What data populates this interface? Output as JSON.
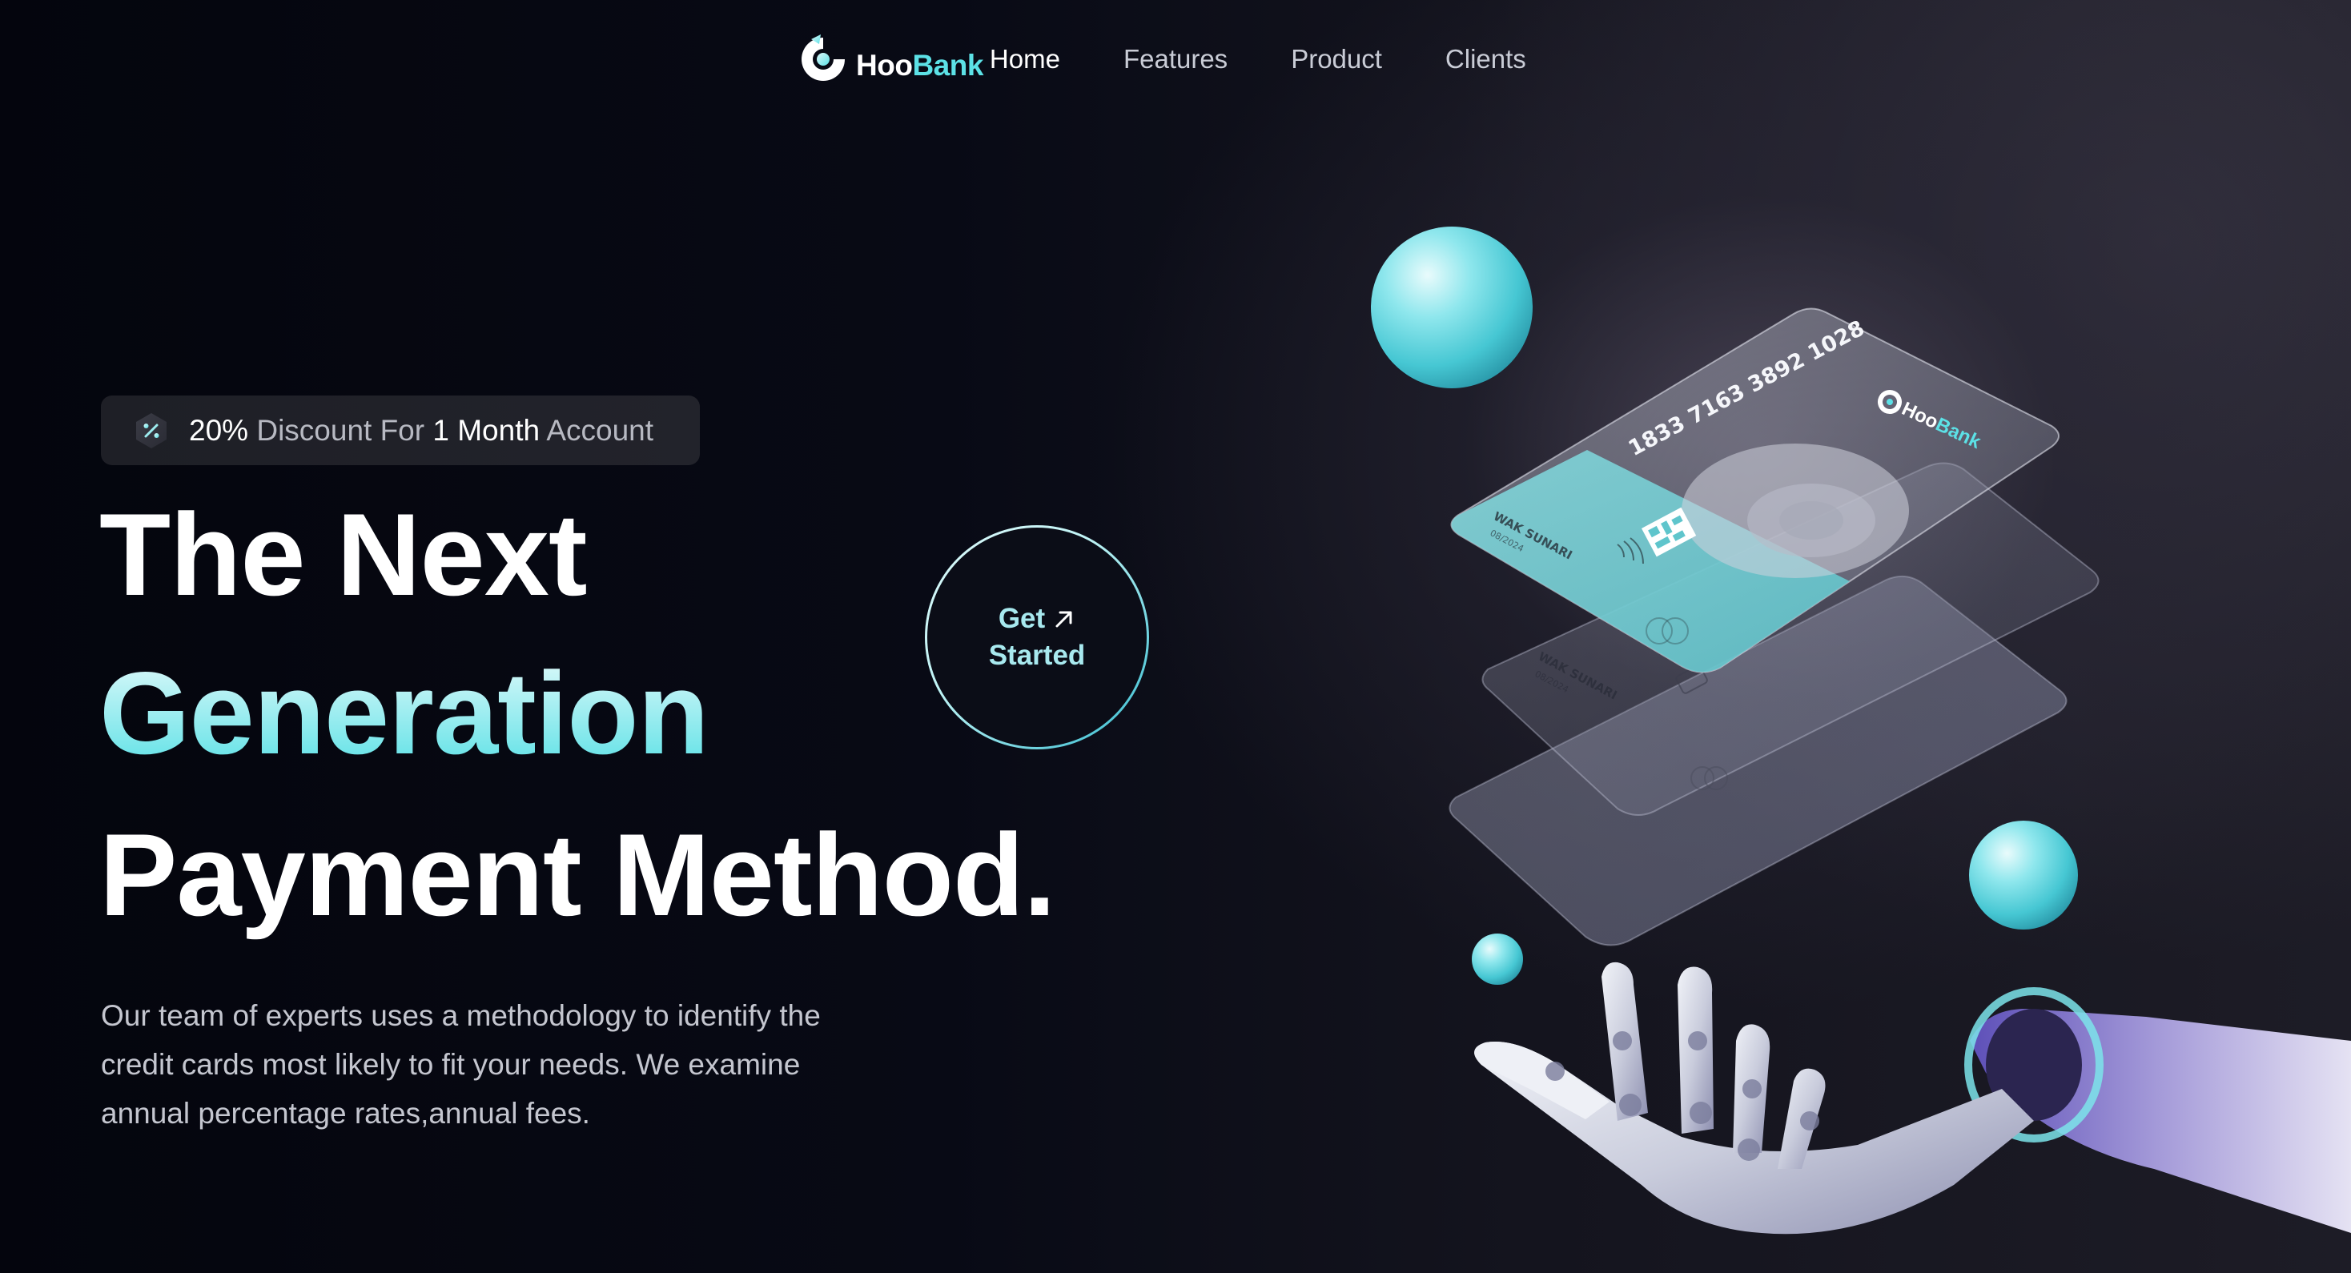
{
  "brand": {
    "name_part1": "Hoo",
    "name_part2": "Bank",
    "accent": "#5ce1e6"
  },
  "nav": {
    "links": [
      "Home",
      "Features",
      "Product",
      "Clients"
    ],
    "active": "Home"
  },
  "badge": {
    "icon": "discount-icon",
    "pct": "20%",
    "word1": "Discount",
    "word2": "For",
    "num": "1",
    "word3": "Month",
    "word4": "Account"
  },
  "hero": {
    "line1": "The Next",
    "line2": "Generation",
    "line3": "Payment Method.",
    "description": "Our team of experts uses a methodology to identify the credit cards most likely to fit your needs. We examine annual percentage rates,annual fees."
  },
  "cta": {
    "line1": "Get",
    "line2": "Started",
    "icon": "arrow-up-right-icon"
  },
  "cards": {
    "number": "1833 7163 3892 1028",
    "holder": "WAK SUNARI",
    "expiry": "08/2024",
    "logo_part1": "Hoo",
    "logo_part2": "Bank"
  },
  "colors": {
    "background": "#070913",
    "accent": "#5ce1e6",
    "gradient_light": "#def9fa"
  }
}
